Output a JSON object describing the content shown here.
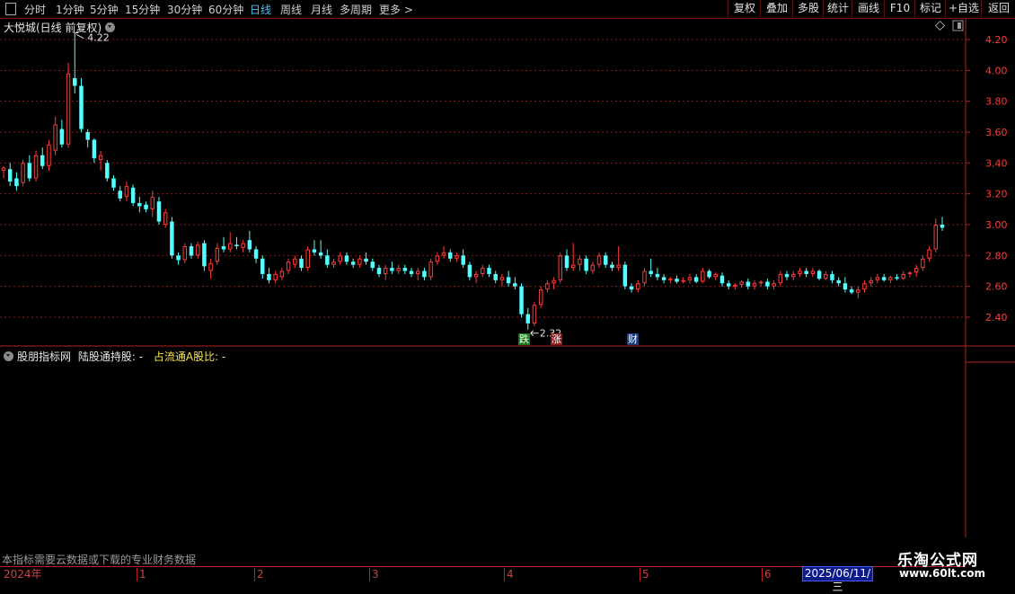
{
  "toolbar": {
    "periods": [
      "分时",
      "1分钟",
      "5分钟",
      "15分钟",
      "30分钟",
      "60分钟",
      "日线",
      "周线",
      "月线",
      "多周期",
      "更多 >"
    ],
    "active_period": "日线",
    "right_buttons": [
      "复权",
      "叠加",
      "多股",
      "统计",
      "画线",
      "F10",
      "标记",
      "+自选",
      "返回"
    ]
  },
  "main_chart": {
    "title": "大悦城(日线 前复权)",
    "high_marker": "4.22",
    "low_marker": "2.32",
    "tags": {
      "fall": "跌",
      "rise": "涨",
      "finance": "财"
    }
  },
  "sub_chart": {
    "title": "股朋指标网",
    "field1": "陆股通持股: -",
    "field2": "占流通A股比: -"
  },
  "note": "本指标需要云数据或下载的专业财务数据",
  "date_box": "2025/06/11/三",
  "watermark": {
    "line1": "乐淘公式网",
    "line2": "www.60lt.com"
  },
  "colors": {
    "up": "#ff3b3b",
    "down": "#54ffff",
    "grid": "#8b1a1a",
    "axis": "#b32222",
    "active": "#4fc3f7"
  },
  "chart_data": {
    "type": "candlestick",
    "title": "大悦城(日线 前复权)",
    "ylim": [
      2.25,
      4.3
    ],
    "y_ticks": [
      4.2,
      4.0,
      3.8,
      3.6,
      3.4,
      3.2,
      3.0,
      2.8,
      2.6,
      2.4
    ],
    "x_ticks": [
      "2024年",
      "1",
      "2",
      "3",
      "4",
      "5",
      "6"
    ],
    "annotations": {
      "high": 4.22,
      "low": 2.32
    },
    "candles": [
      [
        3.35,
        3.38,
        3.3,
        3.37
      ],
      [
        3.36,
        3.4,
        3.25,
        3.28
      ],
      [
        3.3,
        3.34,
        3.22,
        3.25
      ],
      [
        3.27,
        3.42,
        3.25,
        3.4
      ],
      [
        3.4,
        3.45,
        3.28,
        3.3
      ],
      [
        3.3,
        3.48,
        3.28,
        3.45
      ],
      [
        3.45,
        3.5,
        3.36,
        3.38
      ],
      [
        3.38,
        3.55,
        3.35,
        3.52
      ],
      [
        3.48,
        3.7,
        3.45,
        3.65
      ],
      [
        3.62,
        3.68,
        3.5,
        3.52
      ],
      [
        3.52,
        4.05,
        3.5,
        3.98
      ],
      [
        3.95,
        4.22,
        3.85,
        3.9
      ],
      [
        3.9,
        3.95,
        3.6,
        3.62
      ],
      [
        3.6,
        3.62,
        3.5,
        3.55
      ],
      [
        3.55,
        3.56,
        3.4,
        3.43
      ],
      [
        3.42,
        3.48,
        3.35,
        3.45
      ],
      [
        3.4,
        3.42,
        3.28,
        3.3
      ],
      [
        3.3,
        3.32,
        3.22,
        3.24
      ],
      [
        3.22,
        3.25,
        3.15,
        3.17
      ],
      [
        3.18,
        3.28,
        3.15,
        3.25
      ],
      [
        3.24,
        3.26,
        3.12,
        3.14
      ],
      [
        3.14,
        3.18,
        3.08,
        3.12
      ],
      [
        3.13,
        3.15,
        3.08,
        3.1
      ],
      [
        3.1,
        3.22,
        3.05,
        3.18
      ],
      [
        3.15,
        3.18,
        3.0,
        3.02
      ],
      [
        3.0,
        3.1,
        2.98,
        3.08
      ],
      [
        3.02,
        3.05,
        2.78,
        2.8
      ],
      [
        2.8,
        2.82,
        2.74,
        2.77
      ],
      [
        2.77,
        2.88,
        2.75,
        2.86
      ],
      [
        2.86,
        2.88,
        2.78,
        2.8
      ],
      [
        2.8,
        2.89,
        2.78,
        2.87
      ],
      [
        2.88,
        2.9,
        2.7,
        2.73
      ],
      [
        2.7,
        2.78,
        2.65,
        2.75
      ],
      [
        2.76,
        2.88,
        2.74,
        2.85
      ],
      [
        2.86,
        2.92,
        2.82,
        2.84
      ],
      [
        2.84,
        2.95,
        2.82,
        2.88
      ],
      [
        2.87,
        2.92,
        2.84,
        2.86
      ],
      [
        2.85,
        2.9,
        2.82,
        2.88
      ],
      [
        2.9,
        2.96,
        2.82,
        2.84
      ],
      [
        2.84,
        2.86,
        2.75,
        2.78
      ],
      [
        2.78,
        2.8,
        2.65,
        2.68
      ],
      [
        2.68,
        2.72,
        2.62,
        2.64
      ],
      [
        2.64,
        2.7,
        2.62,
        2.68
      ],
      [
        2.66,
        2.72,
        2.64,
        2.7
      ],
      [
        2.7,
        2.78,
        2.68,
        2.76
      ],
      [
        2.74,
        2.8,
        2.72,
        2.78
      ],
      [
        2.78,
        2.8,
        2.7,
        2.72
      ],
      [
        2.72,
        2.86,
        2.7,
        2.84
      ],
      [
        2.84,
        2.9,
        2.8,
        2.82
      ],
      [
        2.82,
        2.9,
        2.78,
        2.8
      ],
      [
        2.8,
        2.84,
        2.72,
        2.74
      ],
      [
        2.74,
        2.78,
        2.72,
        2.76
      ],
      [
        2.76,
        2.82,
        2.74,
        2.8
      ],
      [
        2.8,
        2.82,
        2.74,
        2.76
      ],
      [
        2.76,
        2.78,
        2.72,
        2.74
      ],
      [
        2.74,
        2.8,
        2.72,
        2.78
      ],
      [
        2.78,
        2.82,
        2.74,
        2.76
      ],
      [
        2.76,
        2.78,
        2.7,
        2.72
      ],
      [
        2.72,
        2.74,
        2.66,
        2.68
      ],
      [
        2.68,
        2.74,
        2.64,
        2.72
      ],
      [
        2.72,
        2.76,
        2.68,
        2.7
      ],
      [
        2.7,
        2.74,
        2.68,
        2.72
      ],
      [
        2.72,
        2.74,
        2.68,
        2.7
      ],
      [
        2.7,
        2.72,
        2.66,
        2.68
      ],
      [
        2.68,
        2.72,
        2.64,
        2.7
      ],
      [
        2.7,
        2.72,
        2.64,
        2.66
      ],
      [
        2.66,
        2.78,
        2.64,
        2.76
      ],
      [
        2.76,
        2.82,
        2.74,
        2.8
      ],
      [
        2.8,
        2.86,
        2.78,
        2.82
      ],
      [
        2.82,
        2.84,
        2.76,
        2.78
      ],
      [
        2.78,
        2.82,
        2.76,
        2.8
      ],
      [
        2.8,
        2.84,
        2.72,
        2.74
      ],
      [
        2.74,
        2.76,
        2.64,
        2.66
      ],
      [
        2.66,
        2.7,
        2.62,
        2.68
      ],
      [
        2.68,
        2.74,
        2.66,
        2.72
      ],
      [
        2.72,
        2.74,
        2.66,
        2.68
      ],
      [
        2.68,
        2.7,
        2.62,
        2.64
      ],
      [
        2.64,
        2.68,
        2.6,
        2.66
      ],
      [
        2.66,
        2.7,
        2.6,
        2.62
      ],
      [
        2.62,
        2.66,
        2.58,
        2.6
      ],
      [
        2.6,
        2.62,
        2.4,
        2.42
      ],
      [
        2.42,
        2.46,
        2.32,
        2.36
      ],
      [
        2.36,
        2.5,
        2.34,
        2.48
      ],
      [
        2.48,
        2.6,
        2.46,
        2.58
      ],
      [
        2.58,
        2.64,
        2.56,
        2.62
      ],
      [
        2.62,
        2.66,
        2.58,
        2.64
      ],
      [
        2.64,
        2.82,
        2.62,
        2.8
      ],
      [
        2.8,
        2.84,
        2.7,
        2.72
      ],
      [
        2.72,
        2.88,
        2.7,
        2.74
      ],
      [
        2.74,
        2.8,
        2.7,
        2.78
      ],
      [
        2.78,
        2.8,
        2.68,
        2.7
      ],
      [
        2.7,
        2.76,
        2.68,
        2.74
      ],
      [
        2.74,
        2.82,
        2.72,
        2.8
      ],
      [
        2.8,
        2.82,
        2.72,
        2.74
      ],
      [
        2.74,
        2.76,
        2.7,
        2.72
      ],
      [
        2.72,
        2.86,
        2.7,
        2.74
      ],
      [
        2.74,
        2.76,
        2.58,
        2.6
      ],
      [
        2.6,
        2.62,
        2.56,
        2.58
      ],
      [
        2.58,
        2.64,
        2.56,
        2.62
      ],
      [
        2.62,
        2.72,
        2.6,
        2.7
      ],
      [
        2.7,
        2.78,
        2.66,
        2.68
      ],
      [
        2.68,
        2.72,
        2.64,
        2.66
      ],
      [
        2.66,
        2.68,
        2.62,
        2.64
      ],
      [
        2.64,
        2.66,
        2.62,
        2.65
      ],
      [
        2.65,
        2.67,
        2.62,
        2.63
      ],
      [
        2.63,
        2.66,
        2.62,
        2.64
      ],
      [
        2.64,
        2.68,
        2.62,
        2.66
      ],
      [
        2.66,
        2.68,
        2.62,
        2.63
      ],
      [
        2.63,
        2.72,
        2.62,
        2.7
      ],
      [
        2.7,
        2.71,
        2.65,
        2.66
      ],
      [
        2.66,
        2.69,
        2.64,
        2.68
      ],
      [
        2.67,
        2.69,
        2.6,
        2.62
      ],
      [
        2.62,
        2.64,
        2.58,
        2.6
      ],
      [
        2.6,
        2.62,
        2.58,
        2.61
      ],
      [
        2.61,
        2.64,
        2.59,
        2.63
      ],
      [
        2.63,
        2.65,
        2.58,
        2.6
      ],
      [
        2.6,
        2.64,
        2.58,
        2.62
      ],
      [
        2.62,
        2.64,
        2.6,
        2.63
      ],
      [
        2.63,
        2.65,
        2.58,
        2.6
      ],
      [
        2.6,
        2.64,
        2.58,
        2.62
      ],
      [
        2.62,
        2.7,
        2.6,
        2.68
      ],
      [
        2.68,
        2.7,
        2.64,
        2.66
      ],
      [
        2.66,
        2.7,
        2.64,
        2.68
      ],
      [
        2.68,
        2.72,
        2.66,
        2.7
      ],
      [
        2.7,
        2.72,
        2.66,
        2.68
      ],
      [
        2.68,
        2.72,
        2.66,
        2.7
      ],
      [
        2.7,
        2.71,
        2.64,
        2.65
      ],
      [
        2.65,
        2.7,
        2.64,
        2.68
      ],
      [
        2.68,
        2.7,
        2.62,
        2.64
      ],
      [
        2.64,
        2.66,
        2.6,
        2.62
      ],
      [
        2.62,
        2.66,
        2.56,
        2.58
      ],
      [
        2.58,
        2.6,
        2.55,
        2.56
      ],
      [
        2.56,
        2.6,
        2.52,
        2.58
      ],
      [
        2.58,
        2.64,
        2.56,
        2.62
      ],
      [
        2.62,
        2.66,
        2.6,
        2.64
      ],
      [
        2.64,
        2.68,
        2.62,
        2.66
      ],
      [
        2.66,
        2.68,
        2.63,
        2.64
      ],
      [
        2.64,
        2.67,
        2.62,
        2.66
      ],
      [
        2.66,
        2.68,
        2.64,
        2.65
      ],
      [
        2.65,
        2.7,
        2.64,
        2.68
      ],
      [
        2.68,
        2.7,
        2.66,
        2.69
      ],
      [
        2.69,
        2.74,
        2.66,
        2.72
      ],
      [
        2.72,
        2.8,
        2.7,
        2.78
      ],
      [
        2.78,
        2.86,
        2.76,
        2.84
      ],
      [
        2.84,
        3.04,
        2.82,
        3.0
      ],
      [
        3.0,
        3.05,
        2.96,
        2.98
      ]
    ]
  }
}
